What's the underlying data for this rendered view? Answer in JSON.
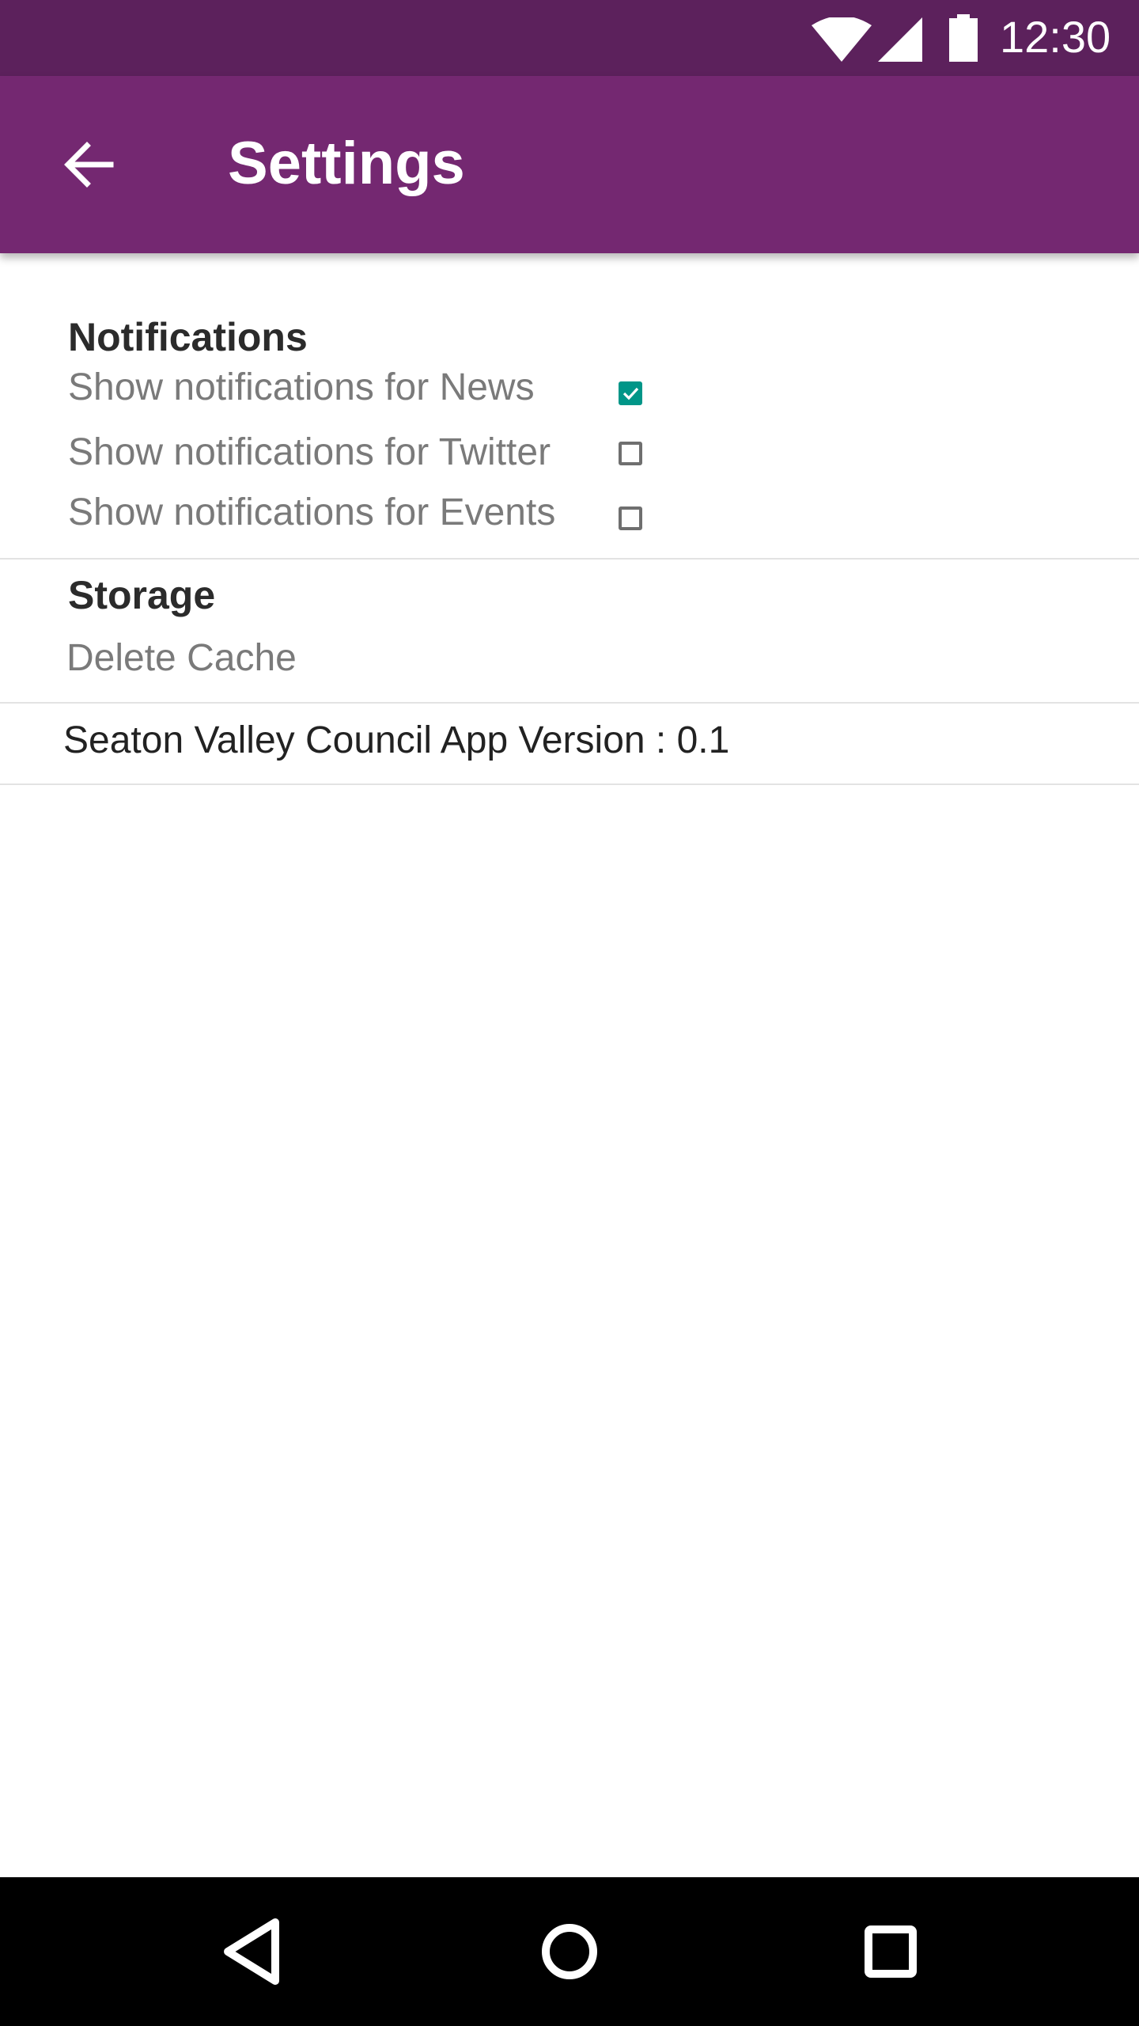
{
  "status_bar": {
    "time": "12:30",
    "icons": [
      "wifi-icon",
      "signal-icon",
      "battery-icon"
    ]
  },
  "app_bar": {
    "title": "Settings",
    "back_icon": "arrow-back-icon"
  },
  "notifications": {
    "header": "Notifications",
    "items": [
      {
        "label": "Show notifications for News",
        "checked": true
      },
      {
        "label": "Show notifications for Twitter",
        "checked": false
      },
      {
        "label": "Show notifications for Events",
        "checked": false
      }
    ]
  },
  "storage": {
    "header": "Storage",
    "delete_cache_label": "Delete Cache"
  },
  "version": {
    "text": "Seaton Valley Council App Version : 0.1"
  },
  "nav_bar": {
    "icons": [
      "nav-back-icon",
      "nav-home-icon",
      "nav-recents-icon"
    ]
  },
  "colors": {
    "status_bar": "#5c215c",
    "app_bar": "#742871",
    "accent": "#009688",
    "nav_bar": "#000000"
  }
}
